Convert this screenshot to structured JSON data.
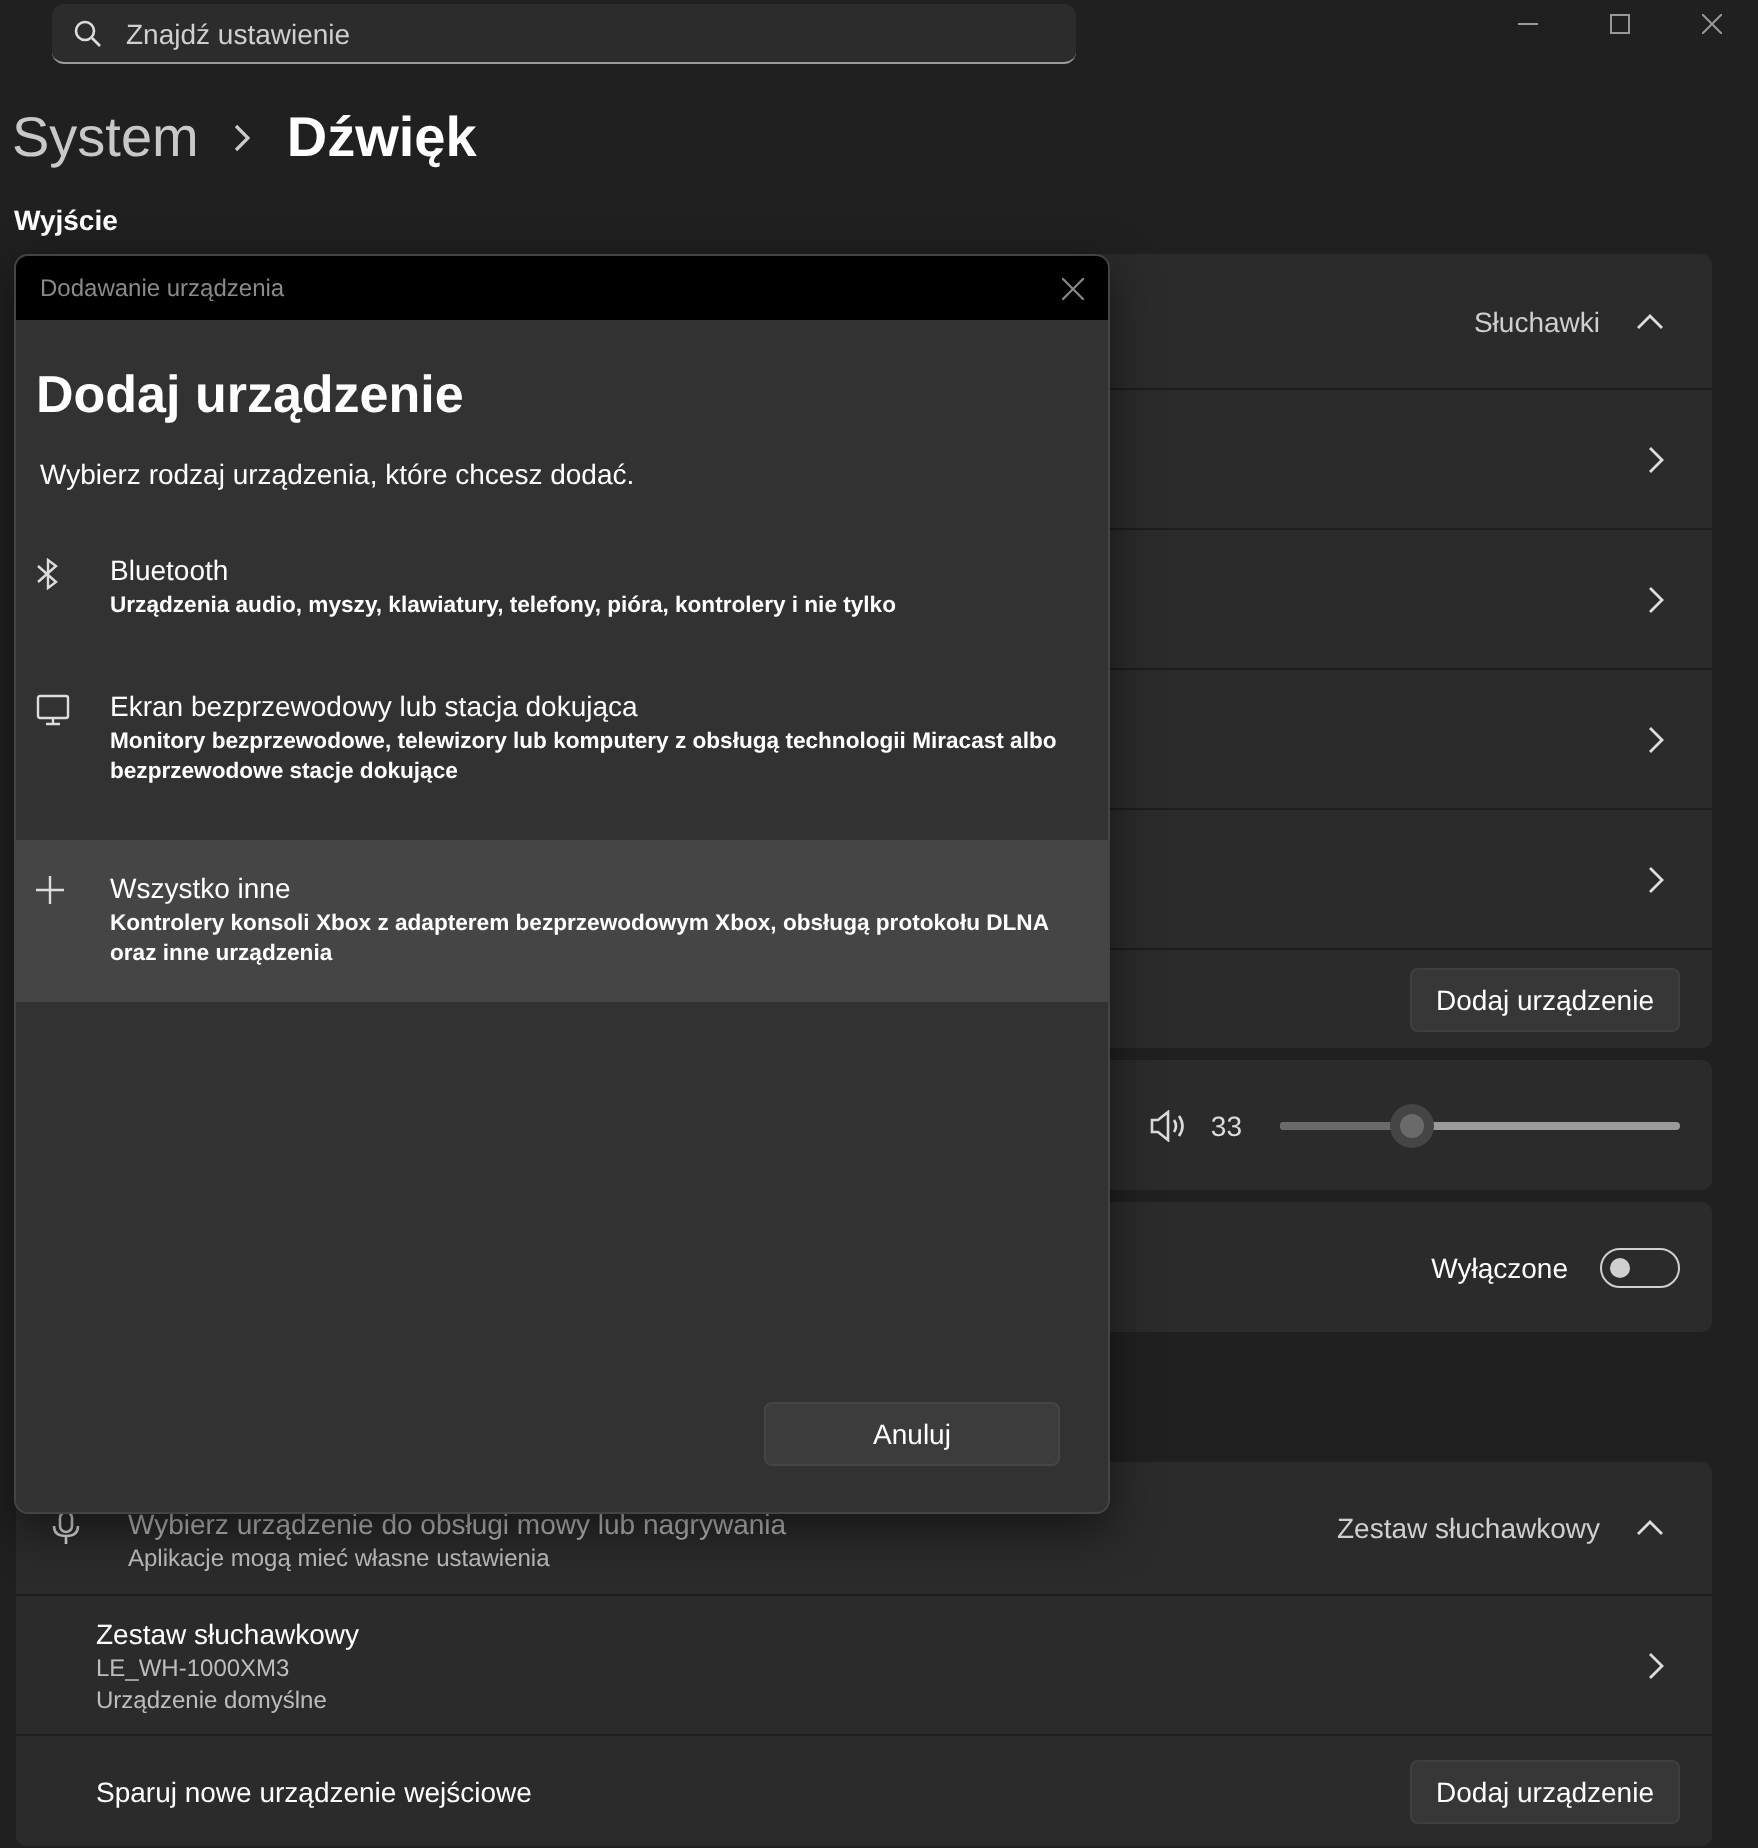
{
  "search": {
    "placeholder": "Znajdź ustawienie"
  },
  "breadcrumb": [
    {
      "label": "System",
      "current": false
    },
    {
      "label": "Dźwięk",
      "current": true
    }
  ],
  "output": {
    "heading": "Wyjście",
    "header": {
      "value": "Słuchawki",
      "expanded": true
    },
    "rows": [
      {
        "kind": "link"
      },
      {
        "kind": "link"
      },
      {
        "kind": "link"
      },
      {
        "kind": "link"
      },
      {
        "kind": "button",
        "button": "Dodaj urządzenie"
      }
    ],
    "volume": {
      "reading": "33",
      "level": 0.33
    },
    "toggle": {
      "label": "Wyłączone",
      "on": false
    }
  },
  "input": {
    "header": {
      "title": "Wybierz urządzenie do obsługi mowy lub nagrywania",
      "subtitle": "Aplikacje mogą mieć własne ustawienia",
      "value": "Zestaw słuchawkowy",
      "expanded": true
    },
    "devices": [
      {
        "name": "Zestaw słuchawkowy",
        "model": "LE_WH-1000XM3",
        "status": "Urządzenie domyślne"
      }
    ],
    "pair": {
      "label": "Sparuj nowe urządzenie wejściowe",
      "button": "Dodaj urządzenie"
    }
  },
  "dialog": {
    "title": "Dodawanie urządzenia",
    "heading": "Dodaj urządzenie",
    "prompt": "Wybierz rodzaj urządzenia, które chcesz dodać.",
    "options": [
      {
        "kind": "bluetooth",
        "title": "Bluetooth",
        "description": "Urządzenia audio, myszy, klawiatury, telefony, pióra, kontrolery i nie tylko",
        "selected": false
      },
      {
        "kind": "display",
        "title": "Ekran bezprzewodowy lub stacja dokująca",
        "description": "Monitory bezprzewodowe, telewizory lub komputery z obsługą technologii Miracast albo bezprzewodowe stacje dokujące",
        "selected": false
      },
      {
        "kind": "other",
        "title": "Wszystko inne",
        "description": "Kontrolery konsoli Xbox z adapterem bezprzewodowym Xbox, obsługą protokołu DLNA oraz inne urządzenia",
        "selected": true
      }
    ],
    "cancel": "Anuluj"
  }
}
